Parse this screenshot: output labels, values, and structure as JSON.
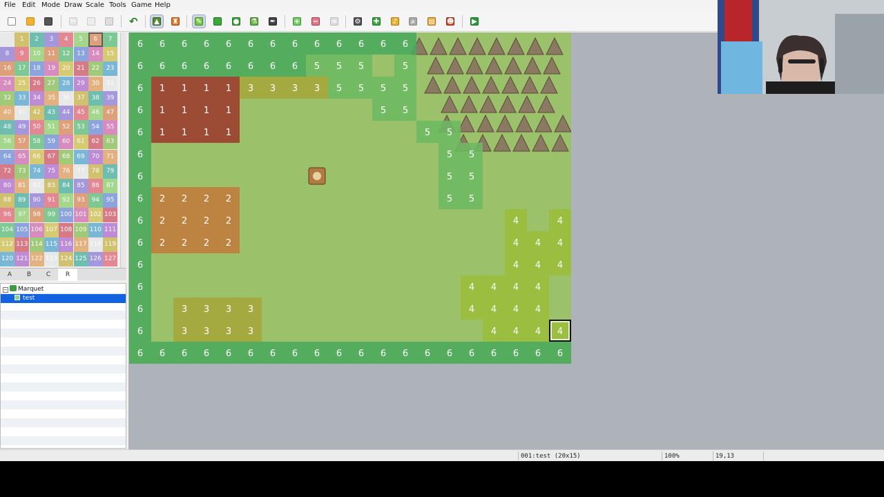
{
  "menu": [
    "File",
    "Edit",
    "Mode",
    "Draw",
    "Scale",
    "Tools",
    "Game",
    "Help"
  ],
  "toolbar": {
    "buttons": [
      {
        "name": "new-project-icon",
        "active": false
      },
      {
        "name": "open-project-icon",
        "active": false
      },
      {
        "name": "save-project-icon",
        "active": false
      },
      {
        "name": "cut-icon",
        "active": false
      },
      {
        "name": "copy-icon",
        "active": false
      },
      {
        "name": "paste-icon",
        "active": false
      },
      {
        "name": "undo-icon",
        "active": false
      },
      {
        "name": "map-mode-icon",
        "active": true
      },
      {
        "name": "event-mode-icon",
        "active": false
      },
      {
        "name": "pencil-icon",
        "active": true
      },
      {
        "name": "rectangle-icon",
        "active": false
      },
      {
        "name": "ellipse-icon",
        "active": false
      },
      {
        "name": "flood-fill-icon",
        "active": false
      },
      {
        "name": "shadow-pen-icon",
        "active": false
      },
      {
        "name": "zoom-in-icon",
        "active": false
      },
      {
        "name": "zoom-out-icon",
        "active": false
      },
      {
        "name": "actual-size-icon",
        "active": false
      },
      {
        "name": "database-icon",
        "active": false
      },
      {
        "name": "plugin-manager-icon",
        "active": false
      },
      {
        "name": "sound-test-icon",
        "active": false
      },
      {
        "name": "event-searcher-icon",
        "active": false
      },
      {
        "name": "resource-manager-icon",
        "active": false
      },
      {
        "name": "character-generator-icon",
        "active": false
      },
      {
        "name": "playtest-icon",
        "active": false
      }
    ]
  },
  "palette": {
    "start": 0,
    "end": 127,
    "selected": 6,
    "tabs": [
      "A",
      "B",
      "C",
      "R"
    ],
    "active_tab": "R"
  },
  "tree": {
    "root": "Marquet",
    "child": "test"
  },
  "map": {
    "width": 20,
    "height": 15,
    "region_rows": [
      "6666666666666                  ",
      "66666666555 5",
      "6111133335555",
      "6111100000055",
      "611110000000055",
      "6000000000000055",
      "6000000000000055",
      "6222200000000055",
      "622220000000000004 4",
      "62222000000000000444",
      "60000000000000000444",
      "6000000000000004444",
      "6033330000000004444",
      "60333300000000004444 66",
      "66666666666666666666"
    ],
    "cursor": {
      "col": 19,
      "row": 13
    }
  },
  "status": {
    "map_info": "001:test (20x15)",
    "zoom": "100%",
    "coords": "19,13"
  },
  "colors": {
    "region_6": "#4aa85c",
    "region_5": "#6cba62",
    "region_4": "#9bbd3a",
    "region_1": "#9c3a2e",
    "region_2": "#c27a3a",
    "region_3": "#a6a63a",
    "grass": "#9bc26a"
  }
}
